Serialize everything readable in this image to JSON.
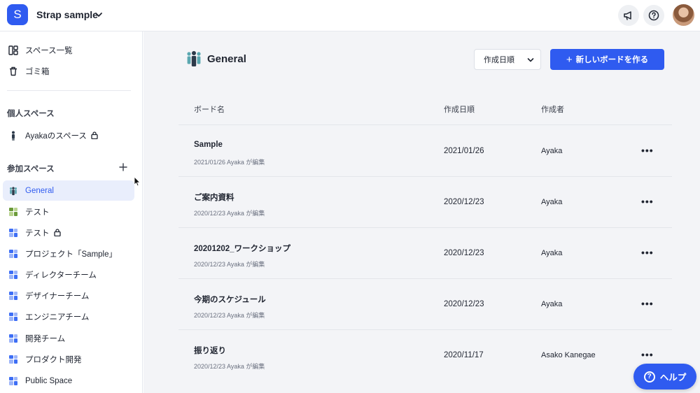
{
  "workspace": {
    "initial": "S",
    "name": "Strap sample"
  },
  "sidebar": {
    "top_items": [
      {
        "label": "スペース一覧",
        "icon": "layout-icon"
      },
      {
        "label": "ゴミ箱",
        "icon": "trash-icon"
      }
    ],
    "personal_section": "個人スペース",
    "personal_items": [
      {
        "label": "Ayakaのスペース",
        "locked": true
      }
    ],
    "joined_section": "参加スペース",
    "joined_items": [
      {
        "label": "General",
        "active": true
      },
      {
        "label": "テスト"
      },
      {
        "label": "テスト",
        "locked": true
      },
      {
        "label": "プロジェクト「Sample」"
      },
      {
        "label": "ディレクターチーム"
      },
      {
        "label": "デザイナーチーム"
      },
      {
        "label": "エンジニアチーム"
      },
      {
        "label": "開発チーム"
      },
      {
        "label": "プロダクト開発"
      },
      {
        "label": "Public Space"
      }
    ]
  },
  "main": {
    "title": "General",
    "sort_value": "作成日順",
    "new_board_label": "新しいボードを作る",
    "columns": {
      "name": "ボード名",
      "date": "作成日順",
      "author": "作成者"
    },
    "rows": [
      {
        "name": "Sample",
        "meta": "2021/01/26 Ayaka が編集",
        "date": "2021/01/26",
        "author": "Ayaka"
      },
      {
        "name": "ご案内資料",
        "meta": "2020/12/23 Ayaka が編集",
        "date": "2020/12/23",
        "author": "Ayaka"
      },
      {
        "name": "20201202_ワークショップ",
        "meta": "2020/12/23 Ayaka が編集",
        "date": "2020/12/23",
        "author": "Ayaka"
      },
      {
        "name": "今期のスケジュール",
        "meta": "2020/12/23 Ayaka が編集",
        "date": "2020/12/23",
        "author": "Ayaka"
      },
      {
        "name": "振り返り",
        "meta": "2020/12/23 Ayaka が編集",
        "date": "2020/11/17",
        "author": "Asako Kanegae"
      }
    ],
    "more_label": "•••"
  },
  "help_label": "ヘルプ",
  "colors": {
    "accent": "#2f5bf0",
    "main_bg": "#f3f4f7",
    "active_bg": "#e9eefc"
  }
}
